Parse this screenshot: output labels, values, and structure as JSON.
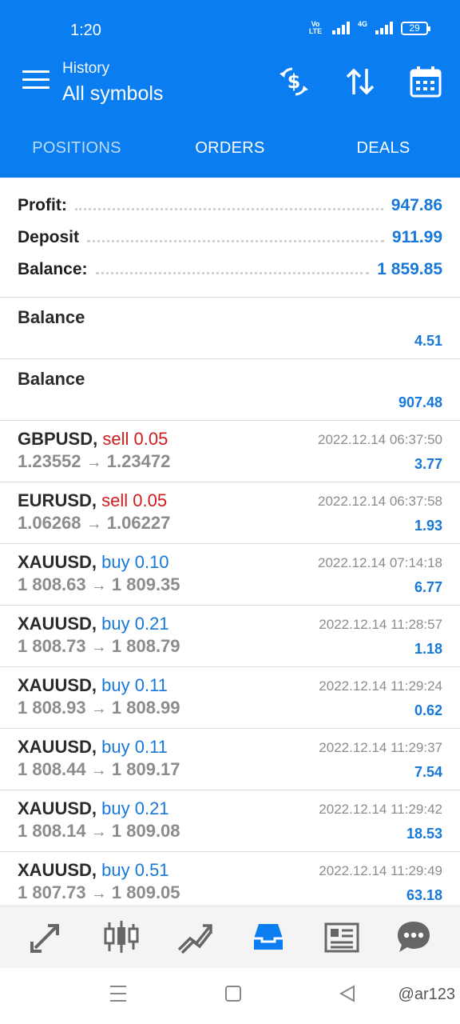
{
  "status_bar": {
    "time": "1:20",
    "network_label_1": "Vo LTE",
    "network_label_2": "4G",
    "battery": "29"
  },
  "toolbar": {
    "subtitle": "History",
    "title": "All symbols",
    "icons": [
      "menu-icon",
      "currency-exchange-icon",
      "sort-icon",
      "calendar-icon"
    ]
  },
  "tabs": [
    {
      "label": "POSITIONS",
      "active": false
    },
    {
      "label": "ORDERS",
      "active": false
    },
    {
      "label": "DEALS",
      "active": false
    }
  ],
  "summary": {
    "profit_label": "Profit:",
    "profit_value": "947.86",
    "deposit_label": "Deposit",
    "deposit_value": "911.99",
    "balance_label": "Balance:",
    "balance_value": "1 859.85"
  },
  "balance_entries": [
    {
      "title": "Balance",
      "value": "4.51"
    },
    {
      "title": "Balance",
      "value": "907.48"
    }
  ],
  "deals": [
    {
      "symbol": "GBPUSD,",
      "side": "sell 0.05",
      "type": "sell",
      "open": "1.23552",
      "close": "1.23472",
      "time": "2022.12.14 06:37:50",
      "profit": "3.77"
    },
    {
      "symbol": "EURUSD,",
      "side": "sell 0.05",
      "type": "sell",
      "open": "1.06268",
      "close": "1.06227",
      "time": "2022.12.14 06:37:58",
      "profit": "1.93"
    },
    {
      "symbol": "XAUUSD,",
      "side": "buy 0.10",
      "type": "buy",
      "open": "1 808.63",
      "close": "1 809.35",
      "time": "2022.12.14 07:14:18",
      "profit": "6.77"
    },
    {
      "symbol": "XAUUSD,",
      "side": "buy 0.21",
      "type": "buy",
      "open": "1 808.73",
      "close": "1 808.79",
      "time": "2022.12.14 11:28:57",
      "profit": "1.18"
    },
    {
      "symbol": "XAUUSD,",
      "side": "buy 0.11",
      "type": "buy",
      "open": "1 808.93",
      "close": "1 808.99",
      "time": "2022.12.14 11:29:24",
      "profit": "0.62"
    },
    {
      "symbol": "XAUUSD,",
      "side": "buy 0.11",
      "type": "buy",
      "open": "1 808.44",
      "close": "1 809.17",
      "time": "2022.12.14 11:29:37",
      "profit": "7.54"
    },
    {
      "symbol": "XAUUSD,",
      "side": "buy 0.21",
      "type": "buy",
      "open": "1 808.14",
      "close": "1 809.08",
      "time": "2022.12.14 11:29:42",
      "profit": "18.53"
    },
    {
      "symbol": "XAUUSD,",
      "side": "buy 0.51",
      "type": "buy",
      "open": "1 807.73",
      "close": "1 809.05",
      "time": "2022.12.14 11:29:49",
      "profit": "63.18"
    }
  ],
  "arrow": "→",
  "bottom_nav": {
    "items": [
      "quotes-icon",
      "chart-icon",
      "trade-icon",
      "history-icon",
      "news-icon",
      "chat-icon"
    ],
    "active": "history-icon"
  },
  "system_nav": {
    "watermark": "@ar123"
  },
  "colors": {
    "accent": "#0a7df0",
    "profit_blue": "#1778d8",
    "sell_red": "#d11c1c",
    "muted": "#8c8c8c"
  }
}
